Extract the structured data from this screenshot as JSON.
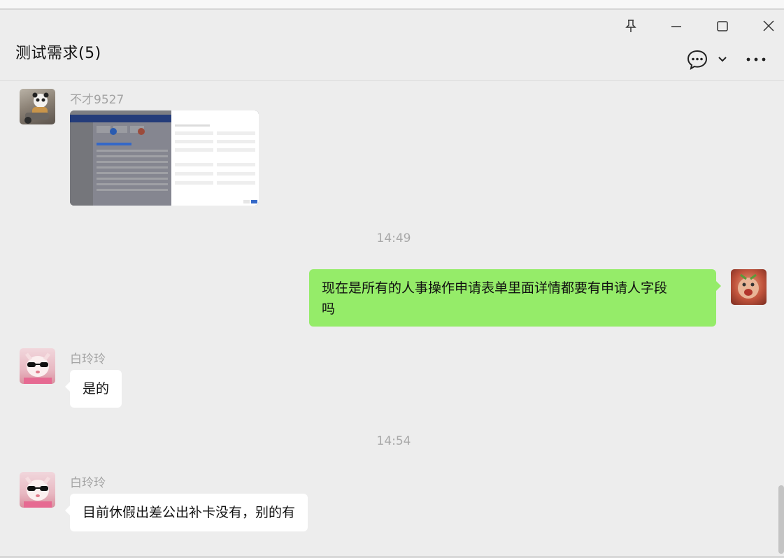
{
  "chat": {
    "title": "测试需求(5)"
  },
  "messages": [
    {
      "sender": "不才9527",
      "type": "image"
    },
    {
      "time": "14:49"
    },
    {
      "type": "text",
      "self": true,
      "text_line1": "现在是所有的人事操作申请表单里面详情都要有申请人字段",
      "text_line2": "吗"
    },
    {
      "sender": "白玲玲",
      "type": "text",
      "text": "是的"
    },
    {
      "time": "14:54"
    },
    {
      "sender": "白玲玲",
      "type": "text",
      "text": "目前休假出差公出补卡没有，别的有"
    }
  ],
  "colors": {
    "self_bubble": "#95ec69",
    "other_bubble": "#ffffff",
    "background": "#ededed"
  },
  "icons": [
    "pin-icon",
    "minimize-icon",
    "maximize-icon",
    "close-icon",
    "chat-bubble-icon",
    "chevron-down-icon",
    "more-icon"
  ]
}
